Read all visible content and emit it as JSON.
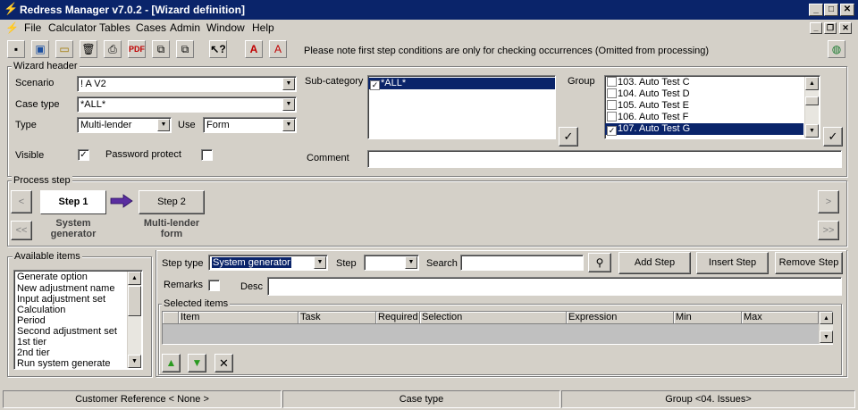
{
  "window": {
    "title": "Redress Manager v7.0.2 - [Wizard definition]"
  },
  "menu": [
    "File",
    "Calculator",
    "Tables",
    "Cases",
    "Admin",
    "Window",
    "Help"
  ],
  "toolbar": {
    "note": "Please note first step conditions are only for checking occurrences (Omitted from processing)"
  },
  "wizard_header": {
    "legend": "Wizard header",
    "scenario_label": "Scenario",
    "scenario_value": "! A V2",
    "case_type_label": "Case type",
    "case_type_value": "*ALL*",
    "type_label": "Type",
    "type_value": "Multi-lender",
    "use_label": "Use",
    "use_value": "Form",
    "visible_label": "Visible",
    "visible_checked": true,
    "password_label": "Password protect",
    "password_checked": false,
    "subcategory_label": "Sub-category",
    "subcategory_items": [
      {
        "label": "*ALL*",
        "checked": true,
        "selected": true
      }
    ],
    "group_label": "Group",
    "group_items": [
      {
        "label": "103. Auto Test C",
        "checked": false,
        "selected": false
      },
      {
        "label": "104. Auto Test D",
        "checked": false,
        "selected": false
      },
      {
        "label": "105. Auto Test E",
        "checked": false,
        "selected": false
      },
      {
        "label": "106. Auto Test F",
        "checked": false,
        "selected": false
      },
      {
        "label": "107. Auto Test G",
        "checked": true,
        "selected": true
      }
    ],
    "comment_label": "Comment",
    "comment_value": ""
  },
  "process_step": {
    "legend": "Process step",
    "nav": {
      "prev": "<",
      "first": "<<",
      "next": ">",
      "last": ">>"
    },
    "steps": [
      {
        "label": "Step 1",
        "caption_line1": "System",
        "caption_line2": "generator"
      },
      {
        "label": "Step 2",
        "caption_line1": "Multi-lender",
        "caption_line2": "form"
      }
    ]
  },
  "available_items": {
    "legend": "Available items",
    "items": [
      "Generate option",
      "New adjustment name",
      "Input adjustment set",
      "Calculation",
      "Period",
      "Second adjustment set",
      "1st tier",
      "2nd tier",
      "Run system generate"
    ]
  },
  "step_editor": {
    "step_type_label": "Step type",
    "step_type_value": "System generator",
    "step_label": "Step",
    "step_value": "",
    "search_label": "Search",
    "search_value": "",
    "add_step": "Add Step",
    "insert_step": "Insert Step",
    "remove_step": "Remove Step",
    "remarks_label": "Remarks",
    "remarks_checked": false,
    "desc_label": "Desc",
    "desc_value": "",
    "selected_legend": "Selected items",
    "columns": [
      "Item",
      "Task",
      "Required",
      "Selection",
      "Expression",
      "Min",
      "Max"
    ]
  },
  "status": {
    "customer_ref": "Customer Reference < None >",
    "case_type": "Case type",
    "group": "Group <04. Issues>"
  }
}
